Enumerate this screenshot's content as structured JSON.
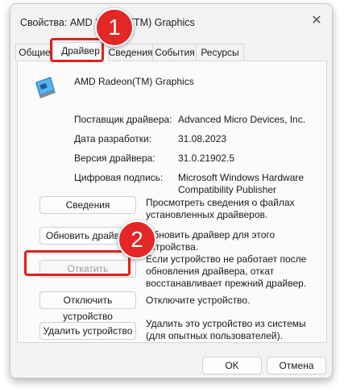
{
  "window": {
    "title": "Свойства: AMD Radeon(TM) Graphics"
  },
  "tabs": [
    {
      "label": "Общие"
    },
    {
      "label": "Драйвер",
      "active": true
    },
    {
      "label": "Сведения"
    },
    {
      "label": "События"
    },
    {
      "label": "Ресурсы"
    }
  ],
  "device": {
    "name": "AMD Radeon(TM) Graphics",
    "icon": "display-adapter-icon"
  },
  "driver_info": {
    "provider_label": "Поставщик драйвера:",
    "provider_value": "Advanced Micro Devices, Inc.",
    "date_label": "Дата разработки:",
    "date_value": "31.08.2023",
    "version_label": "Версия драйвера:",
    "version_value": "31.0.21902.5",
    "signer_label": "Цифровая подпись:",
    "signer_value": "Microsoft Windows Hardware Compatibility Publisher"
  },
  "actions": [
    {
      "button": "Сведения",
      "description": "Просмотреть сведения о файлах установленных драйверов."
    },
    {
      "button": "Обновить драйвер",
      "description": "Обновить драйвер для этого устройства."
    },
    {
      "button": "Откатить",
      "description": "Если устройство не работает после обновления драйвера, откат восстанавливает прежний драйвер.",
      "disabled": true
    },
    {
      "button": "Отключить устройство",
      "description": "Отключите устройство."
    },
    {
      "button": "Удалить устройство",
      "description": "Удалить это устройство из системы (для опытных пользователей)."
    }
  ],
  "footer": {
    "ok": "OK",
    "cancel": "Отмена"
  },
  "annotations": {
    "badge1": "1",
    "badge2": "2",
    "color": "#e32626"
  }
}
